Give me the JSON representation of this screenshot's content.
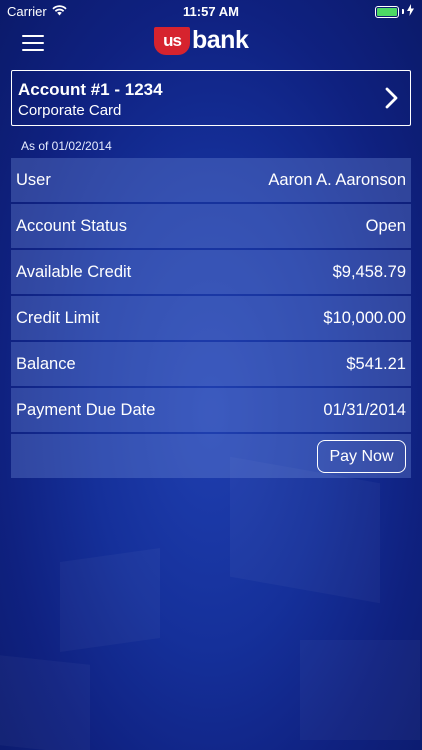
{
  "status_bar": {
    "carrier": "Carrier",
    "time": "11:57 AM",
    "battery_color": "#4cd964"
  },
  "nav": {
    "logo_us": "us",
    "logo_bank": "bank",
    "logo_color": "#d6232e"
  },
  "account": {
    "title": "Account #1 - 1234",
    "subtitle": "Corporate Card"
  },
  "as_of": "As of 01/02/2014",
  "rows": [
    {
      "label": "User",
      "value": "Aaron A. Aaronson"
    },
    {
      "label": "Account Status",
      "value": "Open"
    },
    {
      "label": "Available Credit",
      "value": "$9,458.79"
    },
    {
      "label": "Credit Limit",
      "value": "$10,000.00"
    },
    {
      "label": "Balance",
      "value": "$541.21"
    },
    {
      "label": "Payment Due Date",
      "value": "01/31/2014"
    }
  ],
  "pay_button": "Pay Now"
}
